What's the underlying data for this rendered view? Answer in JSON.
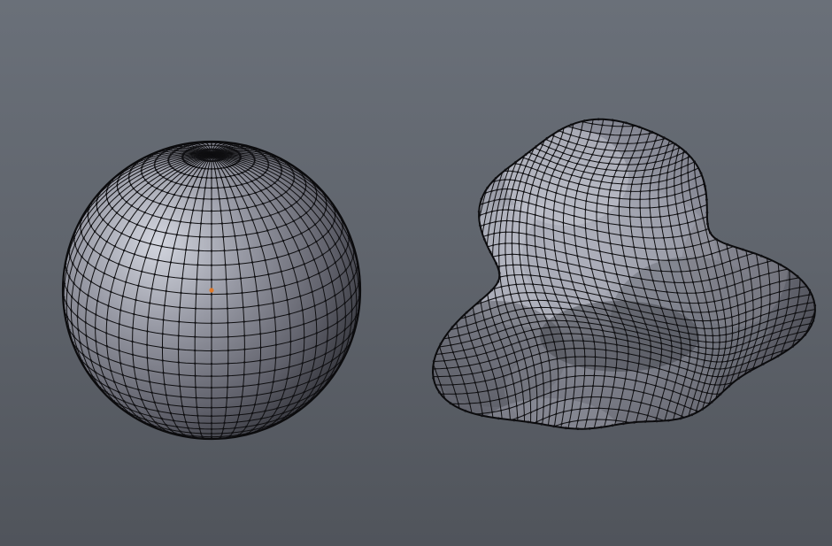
{
  "viewport": {
    "background_top": "#6a7079",
    "background_bottom": "#50545b"
  },
  "objects": [
    {
      "kind": "uv-sphere-mesh",
      "selected": false,
      "has_origin_marker": true,
      "origin_color": "#e07a2a"
    },
    {
      "kind": "displaced-blob-mesh",
      "selected": false,
      "has_origin_marker": false
    }
  ],
  "theme": {
    "wire_color": "#0e0e10",
    "face_light": "#c9ccd6",
    "face_mid": "#8d8f9a",
    "face_dark": "#3e3f46",
    "vertex_color": "#111114"
  }
}
